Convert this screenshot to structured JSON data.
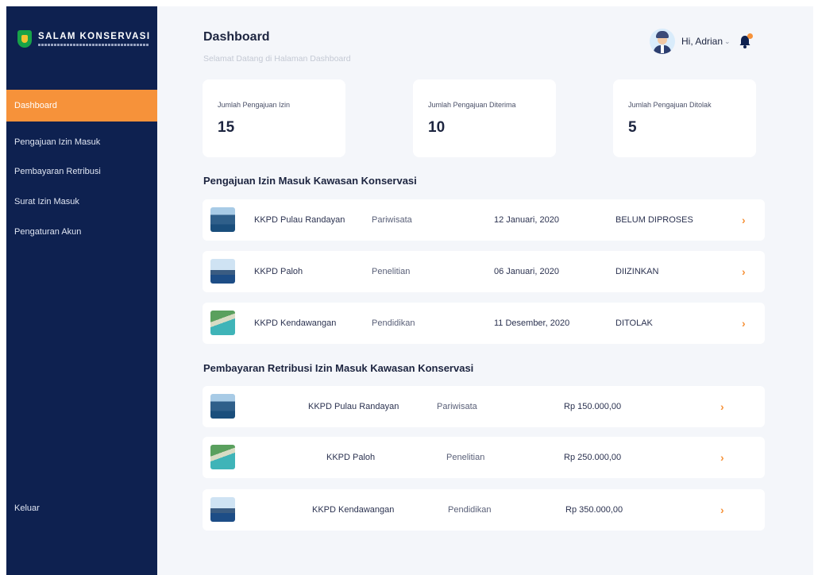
{
  "brand": {
    "title": "SALAM KONSERVASI",
    "accent": "#f6923a",
    "sidebar_bg": "#0e2150",
    "logo_green": "#18a348"
  },
  "sidebar": {
    "items": [
      {
        "label": "Dashboard"
      },
      {
        "label": "Pengajuan Izin Masuk"
      },
      {
        "label": "Pembayaran Retribusi"
      },
      {
        "label": "Surat Izin Masuk"
      },
      {
        "label": "Pengaturan Akun"
      }
    ],
    "active_index": 0,
    "logout": "Keluar"
  },
  "header": {
    "title": "Dashboard",
    "subtitle": "Selamat Datang di Halaman Dashboard",
    "greeting": "Hi, Adrian",
    "icons": [
      "avatar",
      "chevron-down-icon",
      "bell-icon"
    ]
  },
  "stats": [
    {
      "label": "Jumlah Pengajuan Izin",
      "value": "15"
    },
    {
      "label": "Jumlah Pengajuan Diterima",
      "value": "10"
    },
    {
      "label": "Jumlah Pengajuan Ditolak",
      "value": "5"
    }
  ],
  "izin": {
    "title": "Pengajuan Izin Masuk Kawasan Konservasi",
    "rows": [
      {
        "name": "KKPD Pulau Randayan",
        "type": "Pariwisata",
        "date": "12 Januari, 2020",
        "status": "BELUM DIPROSES"
      },
      {
        "name": "KKPD Paloh",
        "type": "Penelitian",
        "date": "06 Januari, 2020",
        "status": "DIIZINKAN"
      },
      {
        "name": "KKPD Kendawangan",
        "type": "Pendidikan",
        "date": "11 Desember, 2020",
        "status": "DITOLAK"
      }
    ]
  },
  "retribusi": {
    "title": "Pembayaran Retribusi Izin Masuk Kawasan Konservasi",
    "rows": [
      {
        "name": "KKPD Pulau Randayan",
        "type": "Pariwisata",
        "amount": "Rp 150.000,00"
      },
      {
        "name": "KKPD Paloh",
        "type": "Penelitian",
        "amount": "Rp 250.000,00"
      },
      {
        "name": "KKPD Kendawangan",
        "type": "Pendidikan",
        "amount": "Rp 350.000,00"
      }
    ]
  }
}
